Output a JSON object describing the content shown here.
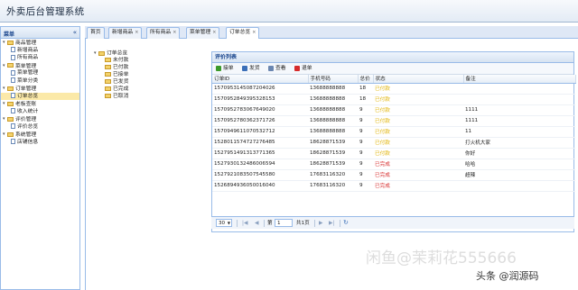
{
  "app": {
    "title": "外卖后台管理系统"
  },
  "sidebar": {
    "title": "菜单",
    "collapse_glyph": "«",
    "items": [
      {
        "label": "商品管理",
        "level": 0,
        "type": "folder",
        "expanded": true
      },
      {
        "label": "新增商品",
        "level": 1,
        "type": "page"
      },
      {
        "label": "所有商品",
        "level": 1,
        "type": "page"
      },
      {
        "label": "菜单管理",
        "level": 0,
        "type": "folder",
        "expanded": true
      },
      {
        "label": "菜单管理",
        "level": 1,
        "type": "page"
      },
      {
        "label": "菜单分类",
        "level": 1,
        "type": "page"
      },
      {
        "label": "订单管理",
        "level": 0,
        "type": "folder",
        "expanded": true
      },
      {
        "label": "订单总览",
        "level": 1,
        "type": "page",
        "selected": true
      },
      {
        "label": "老板查账",
        "level": 0,
        "type": "folder",
        "expanded": true
      },
      {
        "label": "收入统计",
        "level": 1,
        "type": "page"
      },
      {
        "label": "评价管理",
        "level": 0,
        "type": "folder",
        "expanded": true
      },
      {
        "label": "评价总览",
        "level": 1,
        "type": "page"
      },
      {
        "label": "系统管理",
        "level": 0,
        "type": "folder",
        "expanded": true
      },
      {
        "label": "店铺信息",
        "level": 1,
        "type": "page"
      }
    ]
  },
  "tabs": [
    {
      "label": "首页",
      "closable": false,
      "active": false
    },
    {
      "label": "新增商品",
      "closable": true,
      "active": false
    },
    {
      "label": "所有商品",
      "closable": true,
      "active": false
    },
    {
      "label": "菜单管理",
      "closable": true,
      "active": false
    },
    {
      "label": "订单总览",
      "closable": true,
      "active": true
    }
  ],
  "order_tree": {
    "root": "订单总览",
    "children": [
      "未付款",
      "已付款",
      "已接单",
      "已发货",
      "已完成",
      "已取消"
    ]
  },
  "panel": {
    "title": "评价列表",
    "toolbar": [
      {
        "label": "接单",
        "icon": "check-icon",
        "color": "#3a9a2a"
      },
      {
        "label": "发货",
        "icon": "user-icon",
        "color": "#3b6fb8"
      },
      {
        "label": "查看",
        "icon": "search-icon",
        "color": "#6a86b0"
      },
      {
        "label": "退单",
        "icon": "delete-icon",
        "color": "#d62b2b"
      }
    ],
    "columns": [
      "订单ID",
      "手机号码",
      "总价",
      "状态",
      "备注"
    ],
    "rows": [
      {
        "id": "1570953145087204026",
        "phone": "13688888888",
        "total": "18",
        "status": "已付款",
        "note": ""
      },
      {
        "id": "1570952849395328153",
        "phone": "13688888888",
        "total": "18",
        "status": "已付款",
        "note": ""
      },
      {
        "id": "1570952783067649020",
        "phone": "13688888888",
        "total": "9",
        "status": "已付款",
        "note": "1111"
      },
      {
        "id": "1570952780362371726",
        "phone": "13688888888",
        "total": "9",
        "status": "已付款",
        "note": "1111"
      },
      {
        "id": "1570949611070532712",
        "phone": "13688888888",
        "total": "9",
        "status": "已付款",
        "note": "11"
      },
      {
        "id": "1528011574727276485",
        "phone": "18628871539",
        "total": "9",
        "status": "已付款",
        "note": "打火机大家"
      },
      {
        "id": "1527951491313771365",
        "phone": "18628871539",
        "total": "9",
        "status": "已付款",
        "note": "你好"
      },
      {
        "id": "1527930132486006594",
        "phone": "18628871539",
        "total": "9",
        "status": "已完成",
        "note": "哈哈"
      },
      {
        "id": "1527921083507545580",
        "phone": "17683116320",
        "total": "9",
        "status": "已完成",
        "note": "超辣"
      },
      {
        "id": "1526894936050016040",
        "phone": "17683116320",
        "total": "9",
        "status": "已完成",
        "note": ""
      }
    ]
  },
  "pager": {
    "page_size": "30",
    "page_prefix": "第",
    "page_value": "1",
    "page_suffix": "共1页"
  },
  "watermarks": {
    "center": "闲鱼@茉莉花555666",
    "corner": "头条 @润源码"
  },
  "colors": {
    "status_paid": "#e0b200",
    "status_done": "#d62b2b",
    "selected_bg": "#fbe9a8",
    "border": "#99bbe8"
  }
}
